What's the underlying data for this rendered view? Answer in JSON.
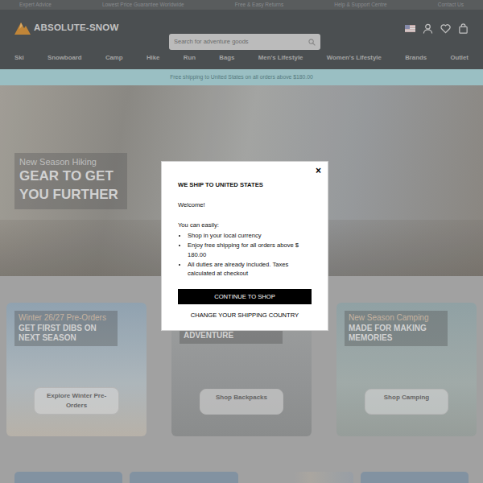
{
  "announcement": [
    "Expert Advice",
    "Lowest Price Guarantee Worldwide",
    "Free & Easy Returns",
    "Help & Support Centre",
    "Contact Us"
  ],
  "logo": {
    "text": "ABSOLUTE-SNOW"
  },
  "search": {
    "placeholder": "Search for adventure goods"
  },
  "nav": [
    "Ski",
    "Snowboard",
    "Camp",
    "Hike",
    "Run",
    "Bags",
    "Men's Lifestyle",
    "Women's Lifestyle",
    "Brands",
    "Outlet"
  ],
  "shipping_banner": "Free shipping to United States on all orders above $180.00",
  "hero": {
    "kicker": "New Season Hiking",
    "title": "GEAR TO GET YOU FURTHER"
  },
  "promos": [
    {
      "kicker": "Winter 26/27 Pre-Orders",
      "title": "GET FIRST DIBS ON NEXT SEASON",
      "button": "Explore Winter Pre-Orders"
    },
    {
      "title": "ADVENTURE",
      "button": "Shop Backpacks"
    },
    {
      "kicker": "New Season Camping",
      "title": "MADE FOR MAKING MEMORIES",
      "button": "Shop Camping"
    }
  ],
  "modal": {
    "close": "×",
    "title": "WE SHIP TO UNITED STATES",
    "greeting": "Welcome!",
    "intro": "You can easily:",
    "bullets": [
      "Shop in your local currency",
      "Enjoy free shipping for all orders above $ 180.00",
      "All duties are already included. Taxes calculated at checkout"
    ],
    "primary_button": "CONTINUE TO SHOP",
    "secondary_link": "CHANGE YOUR SHIPPING COUNTRY"
  }
}
